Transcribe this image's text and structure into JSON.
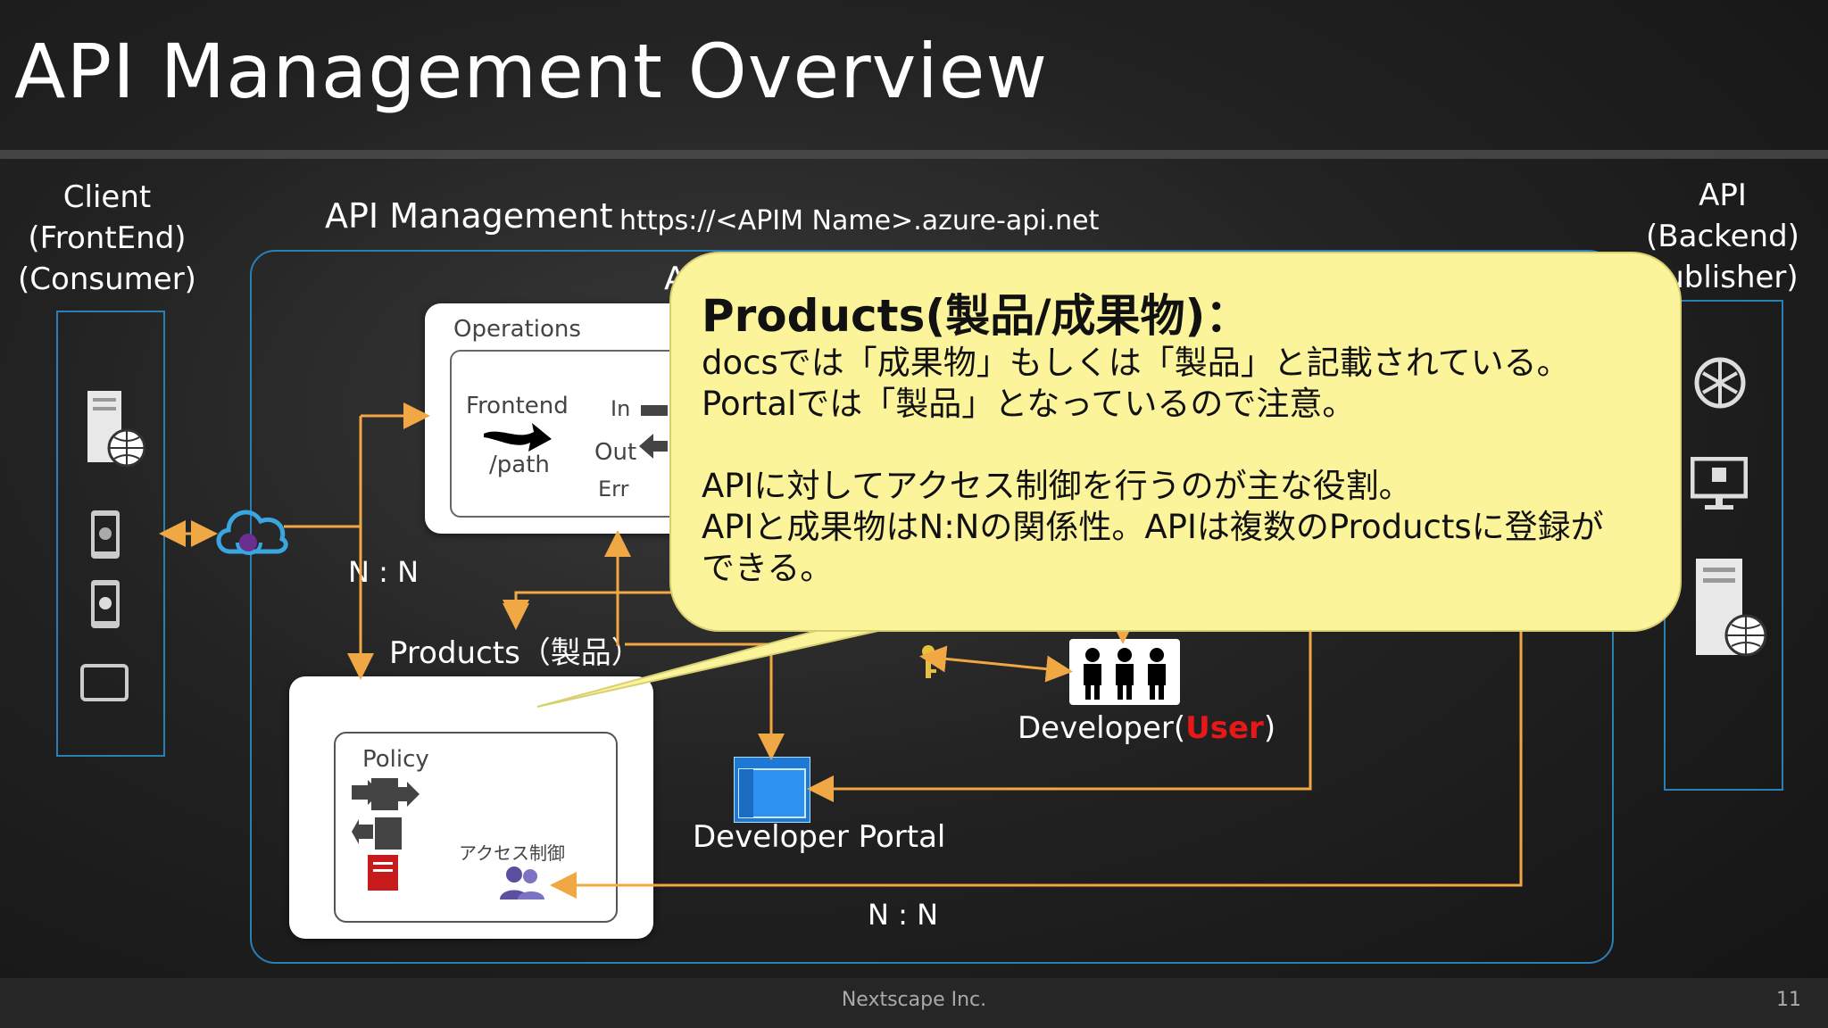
{
  "slide": {
    "title": "API Management Overview",
    "footer_company": "Nextscape Inc.",
    "page_number": "11"
  },
  "client": {
    "line1": "Client",
    "line2": "(FrontEnd)",
    "line3": "(Consumer)"
  },
  "backend": {
    "line1": "API",
    "line2": "(Backend)",
    "line3": "Publisher)"
  },
  "apim": {
    "title": "API Management",
    "url": "https://<APIM Name>.azure-api.net",
    "partial_label": "A"
  },
  "operations": {
    "title": "Operations",
    "frontend": "Frontend",
    "path": "/path",
    "in": "In",
    "out": "Out",
    "err": "Err"
  },
  "products": {
    "label": "Products（製品）",
    "policy": "Policy",
    "access_control": "アクセス制御"
  },
  "relations": {
    "nn_left": "N : N",
    "nn_bottom": "N : N"
  },
  "developer": {
    "prefix": "Developer(",
    "user": "User",
    "suffix": ")"
  },
  "developer_portal": "Developer Portal",
  "callout": {
    "heading": "Products(製品/成果物)：",
    "line1": "docsでは「成果物」もしくは「製品」と記載されている。",
    "line2": "Portalでは「製品」となっているので注意。",
    "line3": "APIに対してアクセス制御を行うのが主な役割。",
    "line4": "APIと成果物はN:Nの関係性。APIは複数のProductsに登録が",
    "line5": "できる。"
  },
  "colors": {
    "accent_orange": "#f0a845",
    "panel_blue": "#2c7fb4",
    "callout_yellow": "#fbf49a",
    "user_red": "#e81818"
  }
}
